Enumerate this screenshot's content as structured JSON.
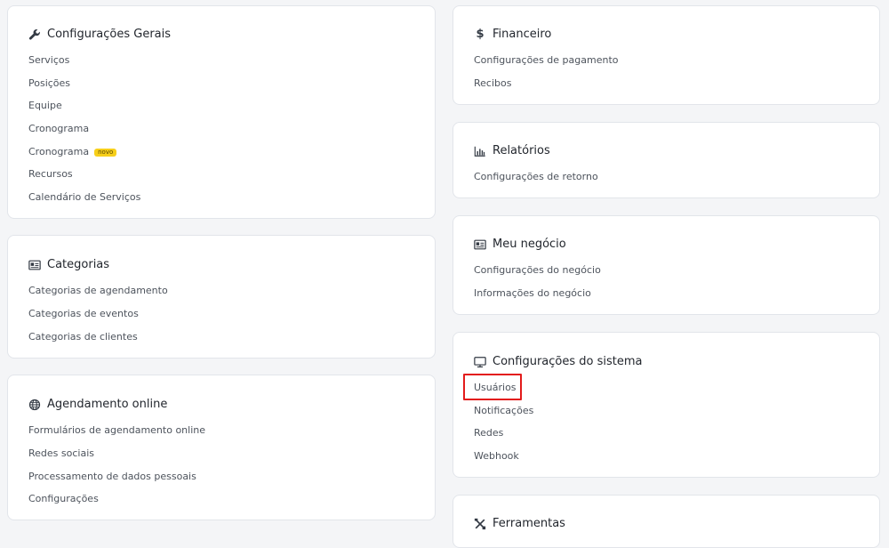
{
  "configuracoes_gerais": {
    "title": "Configurações Gerais",
    "icon": "wrench-icon",
    "items": [
      "Serviços",
      "Posições",
      "Equipe",
      "Cronograma",
      "Cronograma",
      "Recursos",
      "Calendário de Serviços"
    ],
    "badge": "novo"
  },
  "categorias": {
    "title": "Categorias",
    "icon": "id-card-icon",
    "items": [
      "Categorias de agendamento",
      "Categorias de eventos",
      "Categorias de clientes"
    ]
  },
  "agendamento_online": {
    "title": "Agendamento online",
    "icon": "globe-icon",
    "items": [
      "Formulários de agendamento online",
      "Redes sociais",
      "Processamento de dados pessoais",
      "Configurações"
    ]
  },
  "financeiro": {
    "title": "Financeiro",
    "icon": "dollar-icon",
    "items": [
      "Configurações de pagamento",
      "Recibos"
    ]
  },
  "relatorios": {
    "title": "Relatórios",
    "icon": "bar-chart-icon",
    "items": [
      "Configurações de retorno"
    ]
  },
  "meu_negocio": {
    "title": "Meu negócio",
    "icon": "id-card-icon",
    "items": [
      "Configurações do negócio",
      "Informações do negócio"
    ]
  },
  "configuracoes_sistema": {
    "title": "Configurações do sistema",
    "icon": "monitor-icon",
    "items": [
      "Usuários",
      "Notificações",
      "Redes",
      "Webhook"
    ]
  },
  "ferramentas": {
    "title": "Ferramentas",
    "icon": "tools-icon"
  },
  "colors": {
    "badge": "#f7cf1a",
    "highlight": "#e31b1b"
  }
}
